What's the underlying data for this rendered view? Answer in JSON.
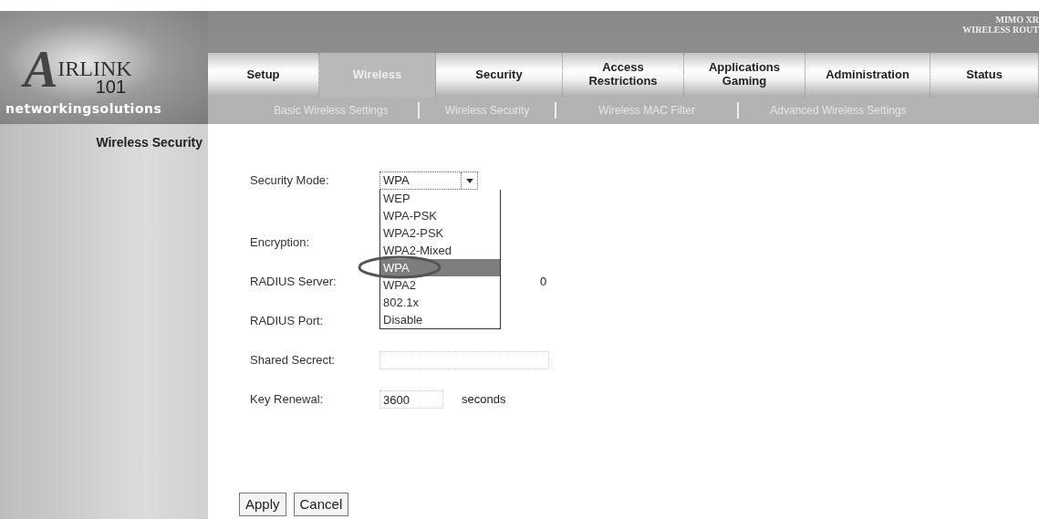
{
  "logo": {
    "letter": "A",
    "word": "IRLINK",
    "number": "101",
    "tagline": "networkingsolutions"
  },
  "product": {
    "line1": "MIMO XR",
    "line2": "WIRELESS ROUT"
  },
  "tabs": [
    {
      "label": "Setup",
      "selected": false
    },
    {
      "label": "Wireless",
      "selected": true
    },
    {
      "label": "Security",
      "selected": false
    },
    {
      "label": "Access Restrictions",
      "selected": false
    },
    {
      "label": "Applications Gaming",
      "selected": false
    },
    {
      "label": "Administration",
      "selected": false
    },
    {
      "label": "Status",
      "selected": false
    }
  ],
  "subnav": [
    {
      "label": "Basic Wireless Settings"
    },
    {
      "label": "Wireless Security"
    },
    {
      "label": "Wireless MAC Filter"
    },
    {
      "label": "Advanced Wireless Settings"
    }
  ],
  "sidebar": {
    "title": "Wireless Security"
  },
  "form": {
    "security_mode": {
      "label": "Security Mode:",
      "value": "WPA",
      "options": [
        {
          "label": "WEP",
          "selected": false
        },
        {
          "label": "WPA-PSK",
          "selected": false
        },
        {
          "label": "WPA2-PSK",
          "selected": false
        },
        {
          "label": "WPA2-Mixed",
          "selected": false
        },
        {
          "label": "WPA",
          "selected": true
        },
        {
          "label": "WPA2",
          "selected": false
        },
        {
          "label": "802.1x",
          "selected": false
        },
        {
          "label": "Disable",
          "selected": false
        }
      ]
    },
    "encryption": {
      "label": "Encryption:"
    },
    "radius_server": {
      "label": "RADIUS Server:",
      "last_octet": "0"
    },
    "radius_port": {
      "label": "RADIUS Port:"
    },
    "shared_secret": {
      "label": "Shared Secrect:"
    },
    "key_renewal": {
      "label": "Key Renewal:",
      "value": "3600",
      "unit": "seconds"
    }
  },
  "buttons": [
    {
      "label": "Apply"
    },
    {
      "label": "Cancel"
    }
  ]
}
